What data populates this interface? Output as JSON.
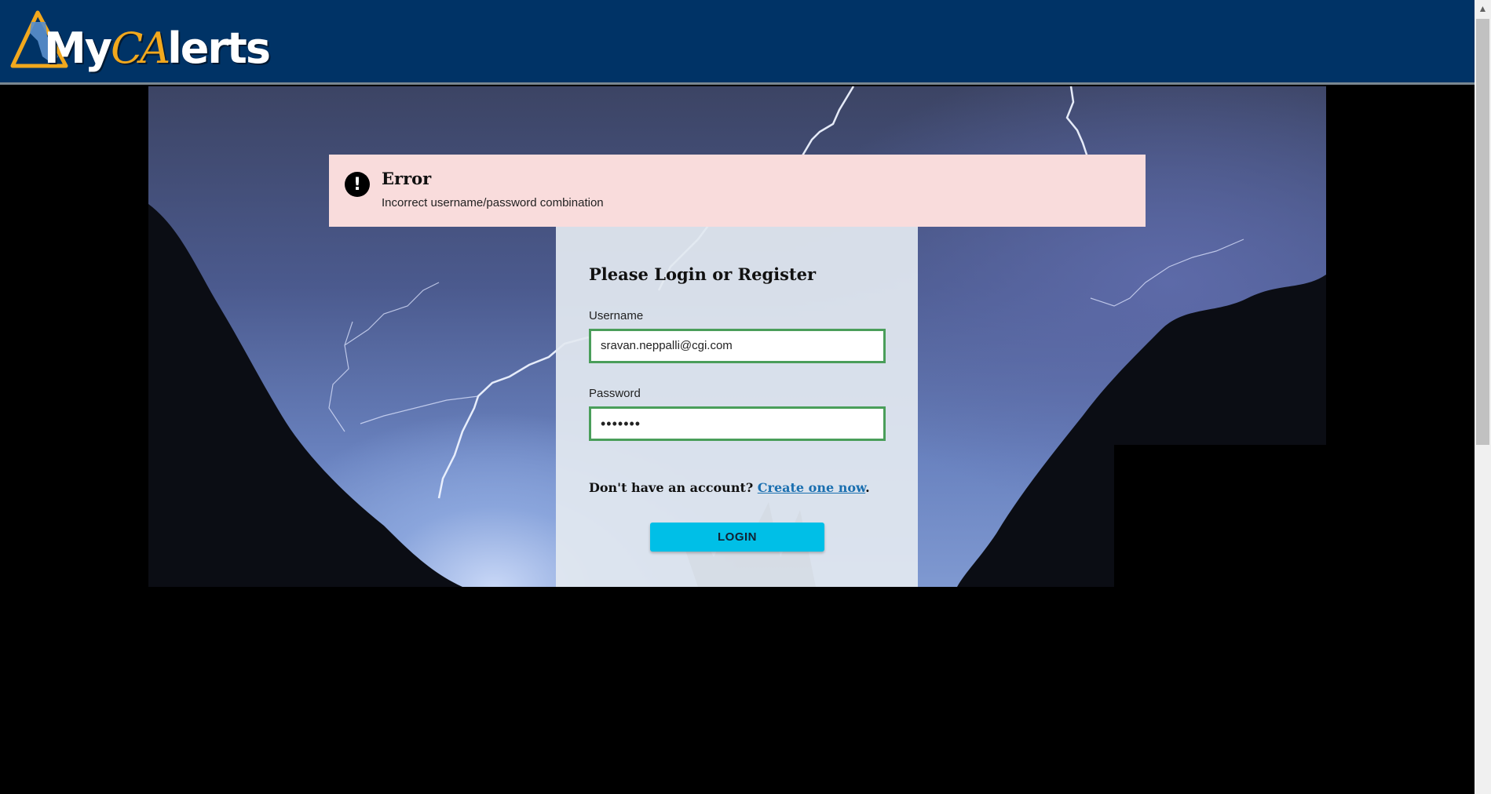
{
  "header": {
    "logo": {
      "my": "My",
      "ca": "CA",
      "lerts": "lerts"
    }
  },
  "error": {
    "icon": "exclamation-icon",
    "title": "Error",
    "message": "Incorrect username/password combination"
  },
  "login": {
    "title": "Please Login or Register",
    "username_label": "Username",
    "username_value": "sravan.neppalli@cgi.com",
    "password_label": "Password",
    "password_value": "•••••••",
    "account_prompt": "Don't have an account?",
    "create_link": "Create one now",
    "period": ".",
    "button_label": "LOGIN"
  },
  "colors": {
    "header": "#003366",
    "error_bg": "#f9dcdc",
    "input_border": "#4a9e5a",
    "button": "#00bfe7",
    "link": "#1a6fb0"
  }
}
